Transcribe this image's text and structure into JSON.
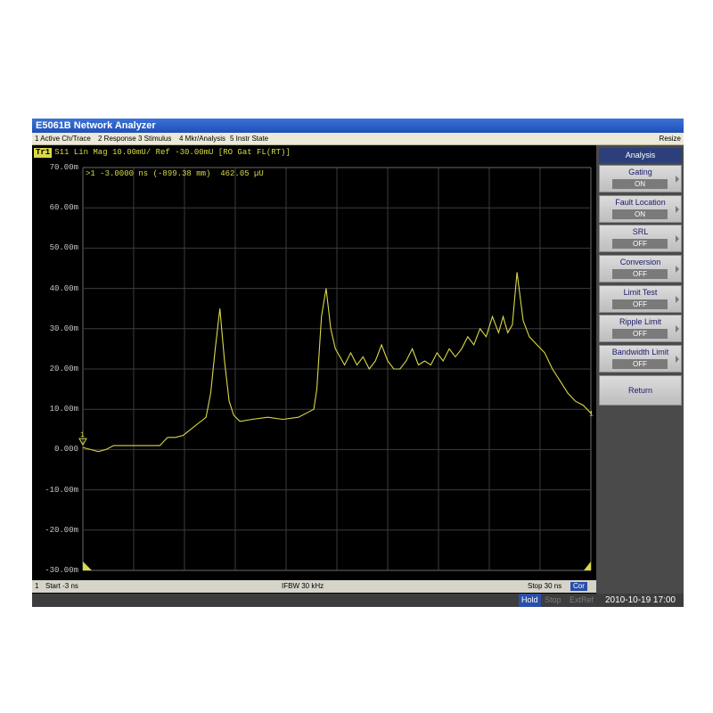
{
  "window": {
    "title": "E5061B Network Analyzer"
  },
  "menu": {
    "items": [
      "1 Active Ch/Trace",
      "2 Response",
      "3 Stimulus",
      "4 Mkr/Analysis",
      "5 Instr State"
    ],
    "resize": "Resize"
  },
  "trace": {
    "tag": "Tr1",
    "header": "S11 Lin Mag 10.00mU/ Ref -30.00mU [RO Gat FL(RT)]",
    "marker_readout": ">1 -3.0000 ns (-899.38 mm)  462.05 µU",
    "marker_label": "1"
  },
  "bottom": {
    "channel": "1",
    "start": "Start -3 ns",
    "ifbw": "IFBW 30 kHz",
    "stop": "Stop 30 ns",
    "cor": "Cor"
  },
  "status": {
    "hold": "Hold",
    "stop": "Stop",
    "extref": "ExtRef",
    "datetime": "2010-10-19 17:00"
  },
  "softpanel": {
    "title": "Analysis",
    "keys": [
      {
        "label": "Gating",
        "value": "ON"
      },
      {
        "label": "Fault Location",
        "value": "ON"
      },
      {
        "label": "SRL",
        "value": "OFF"
      },
      {
        "label": "Conversion",
        "value": "OFF"
      },
      {
        "label": "Limit Test",
        "value": "OFF"
      },
      {
        "label": "Ripple Limit",
        "value": "OFF"
      },
      {
        "label": "Bandwidth Limit",
        "value": "OFF"
      }
    ],
    "return": "Return"
  },
  "colors": {
    "trace": "#d9d94a",
    "grid": "#3c3c3c",
    "accent": "#2a4fa8"
  },
  "chart_data": {
    "type": "line",
    "xlim": [
      -3,
      30
    ],
    "ylim": [
      -30,
      70
    ],
    "yticks": [
      "70.00m",
      "60.00m",
      "50.00m",
      "40.00m",
      "30.00m",
      "20.00m",
      "10.00m",
      "0.000",
      "-10.00m",
      "-20.00m",
      "-30.00m"
    ],
    "series": [
      {
        "x": [
          -3,
          -2.5,
          -2,
          -1.5,
          -1,
          -0.5,
          0,
          0.5,
          1,
          1.5,
          2,
          2.5,
          3,
          3.5,
          4,
          4.5,
          5,
          5.3,
          5.6,
          5.9,
          6.2,
          6.5,
          6.8,
          7.2,
          8,
          9,
          10,
          11,
          12,
          12.2,
          12.5,
          12.8,
          13.1,
          13.4,
          13.7,
          14,
          14.4,
          14.8,
          15.2,
          15.6,
          16,
          16.4,
          16.8,
          17.2,
          17.6,
          18,
          18.4,
          18.8,
          19.2,
          19.6,
          20,
          20.4,
          20.8,
          21.2,
          21.6,
          22,
          22.4,
          22.8,
          23.2,
          23.6,
          24,
          24.3,
          24.6,
          24.9,
          25.2,
          25.6,
          26,
          26.5,
          27,
          27.5,
          28,
          28.5,
          29,
          29.5,
          30
        ],
        "y": [
          0.5,
          0,
          -0.5,
          0,
          1,
          1,
          1,
          1,
          1,
          1,
          1,
          3,
          3,
          3.5,
          5,
          6.5,
          8,
          14,
          25,
          35,
          22,
          12,
          8.5,
          7,
          7.5,
          8,
          7.5,
          8,
          10,
          15,
          33,
          40,
          30,
          25,
          23,
          21,
          24,
          21,
          23,
          20,
          22,
          26,
          22,
          20,
          20,
          22,
          25,
          21,
          22,
          21,
          24,
          22,
          25,
          23,
          25,
          28,
          26,
          30,
          28,
          33,
          29,
          33,
          29,
          31,
          44,
          32,
          28,
          26,
          24,
          20,
          17,
          14,
          12,
          11,
          9
        ]
      }
    ]
  }
}
